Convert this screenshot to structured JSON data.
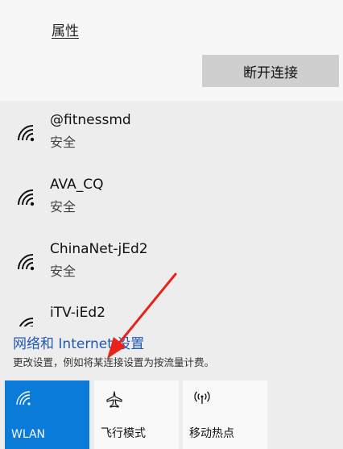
{
  "top": {
    "properties_label": "属性",
    "disconnect_label": "断开连接"
  },
  "networks": [
    {
      "name": "@fitnessmd",
      "status": "安全"
    },
    {
      "name": "AVA_CQ",
      "status": "安全"
    },
    {
      "name": "ChinaNet-jEd2",
      "status": "安全"
    },
    {
      "name": "iTV-iEd2",
      "status": ""
    }
  ],
  "settings": {
    "link_label": "网络和 Internet 设置",
    "description": "更改设置，例如将某连接设置为按流量计费。"
  },
  "tiles": [
    {
      "label": "WLAN",
      "icon": "wifi-icon",
      "active": true
    },
    {
      "label": "飞行模式",
      "icon": "airplane-icon",
      "active": false
    },
    {
      "label": "移动热点",
      "icon": "hotspot-icon",
      "active": false
    }
  ],
  "colors": {
    "accent": "#0a7bd8",
    "link": "#1f57b5",
    "annotation": "#e8231c"
  }
}
